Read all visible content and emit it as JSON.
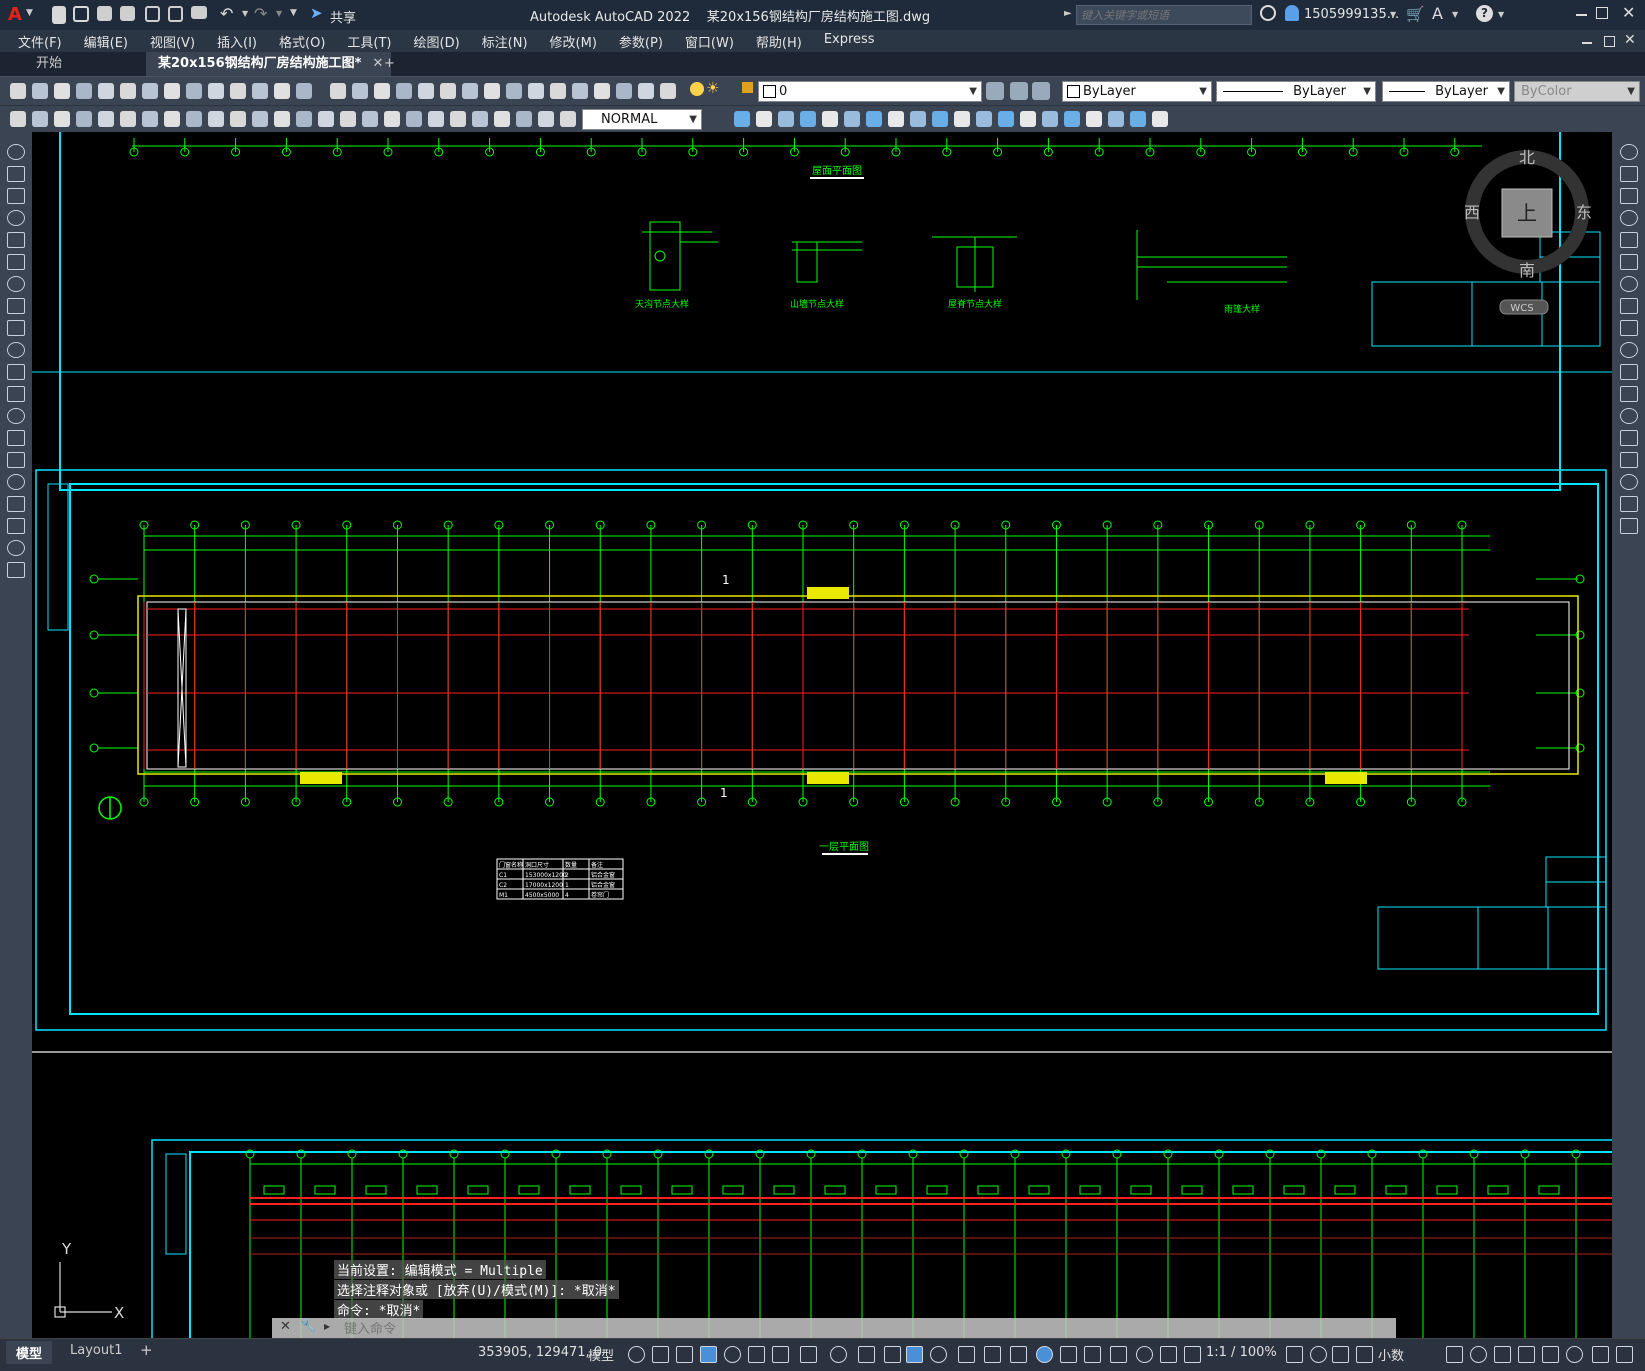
{
  "app": {
    "title": "Autodesk AutoCAD 2022",
    "filename": "某20x156钢结构厂房结构施工图.dwg",
    "share": "共享",
    "search_placeholder": "键入关键字或短语",
    "user": "1505999135...",
    "help": "?"
  },
  "menu": [
    "文件(F)",
    "编辑(E)",
    "视图(V)",
    "插入(I)",
    "格式(O)",
    "工具(T)",
    "绘图(D)",
    "标注(N)",
    "修改(M)",
    "参数(P)",
    "窗口(W)",
    "帮助(H)",
    "Express"
  ],
  "tabs": {
    "start": "开始",
    "active": "某20x156钢结构厂房结构施工图*",
    "close": "✕",
    "add": "+"
  },
  "toolbar": {
    "layer": "0",
    "color": "ByLayer",
    "linetype": "ByLayer",
    "lineweight": "ByLayer",
    "plotstyle": "ByColor",
    "textstyle": "NORMAL"
  },
  "viewcube": {
    "north": "北",
    "south": "南",
    "east": "东",
    "west": "西",
    "top": "上",
    "wcs": "WCS"
  },
  "drawing": {
    "roof_plan_title": "屋面平面图",
    "detail_titles": [
      "天沟节点大样",
      "山墙节点大样",
      "屋脊节点大样",
      "雨篷大样"
    ],
    "floor_plan_title": "一层平面图",
    "section_marks": [
      "1",
      "1"
    ],
    "door_table": {
      "headers": [
        "门窗名称",
        "洞口尺寸",
        "数量",
        "备注"
      ],
      "rows": [
        [
          "C1",
          "153000x1200",
          "2",
          "铝合金窗"
        ],
        [
          "C2",
          "17000x1200",
          "1",
          "铝合金窗"
        ],
        [
          "M1",
          "4500x5000",
          "4",
          "卷帘门"
        ]
      ]
    }
  },
  "commandline": {
    "line1": "当前设置: 编辑模式 = Multiple",
    "line2": "选择注释对象或 [放弃(U)/模式(M)]: *取消*",
    "line3": "命令: *取消*",
    "placeholder": "键入命令"
  },
  "status": {
    "model_tab": "模型",
    "layout_tab": "Layout1",
    "add": "+",
    "coords": "353905, 129471, 0",
    "model": "模型",
    "scale": "1:1 / 100%",
    "units": "小数"
  },
  "ucs": {
    "x": "X",
    "y": "Y"
  },
  "colors": {
    "accent": "#00e5ff",
    "grid_green": "#00ff00",
    "grid_red": "#ff2020",
    "highlight_yellow": "#e8e800"
  }
}
